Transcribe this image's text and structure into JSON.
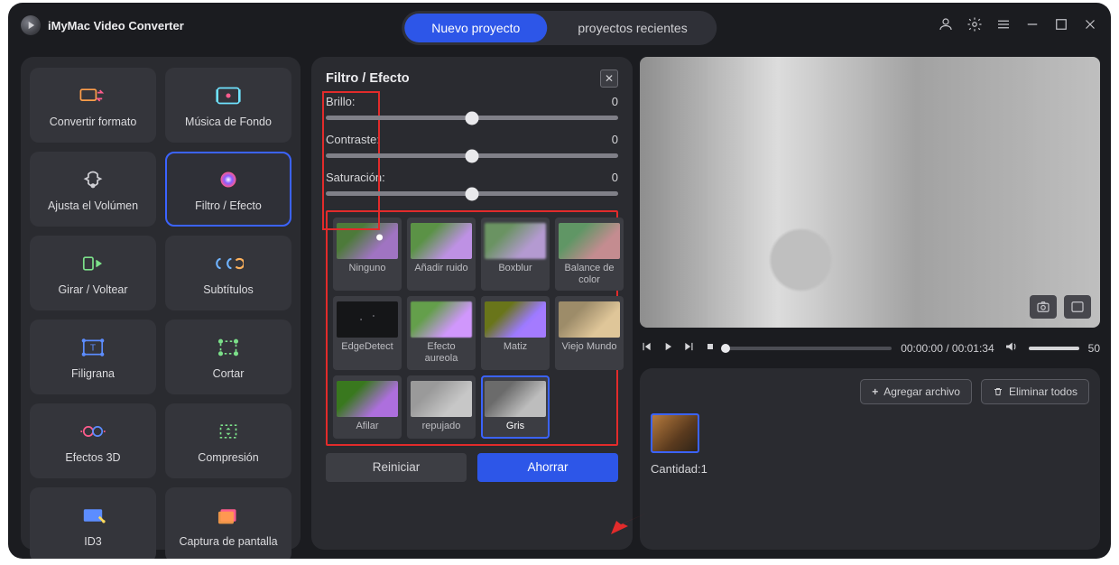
{
  "app_title": "iMyMac Video Converter",
  "tabs": {
    "new": "Nuevo proyecto",
    "recent": "proyectos recientes"
  },
  "sidebar": {
    "items": [
      {
        "label": "Convertir formato"
      },
      {
        "label": "Música de Fondo"
      },
      {
        "label": "Ajusta el Volúmen"
      },
      {
        "label": "Filtro / Efecto"
      },
      {
        "label": "Girar / Voltear"
      },
      {
        "label": "Subtítulos"
      },
      {
        "label": "Filigrana"
      },
      {
        "label": "Cortar"
      },
      {
        "label": "Efectos 3D"
      },
      {
        "label": "Compresión"
      },
      {
        "label": "ID3"
      },
      {
        "label": "Captura de pantalla"
      }
    ],
    "active_index": 3
  },
  "center": {
    "title": "Filtro / Efecto",
    "sliders": [
      {
        "label": "Brillo:",
        "value": "0"
      },
      {
        "label": "Contraste:",
        "value": "0"
      },
      {
        "label": "Saturación:",
        "value": "0"
      }
    ],
    "filters": [
      "Ninguno",
      "Añadir ruido",
      "Boxblur",
      "Balance de color",
      "EdgeDetect",
      "Efecto aureola",
      "Matiz",
      "Viejo Mundo",
      "Afilar",
      "repujado",
      "Gris"
    ],
    "selected_filter_index": 10,
    "reset": "Reiniciar",
    "save": "Ahorrar"
  },
  "playback": {
    "current": "00:00:00",
    "total": "00:01:34",
    "volume": "50"
  },
  "queue": {
    "add": "Agregar archivo",
    "clear": "Eliminar todos",
    "count_label": "Cantidad:1"
  }
}
